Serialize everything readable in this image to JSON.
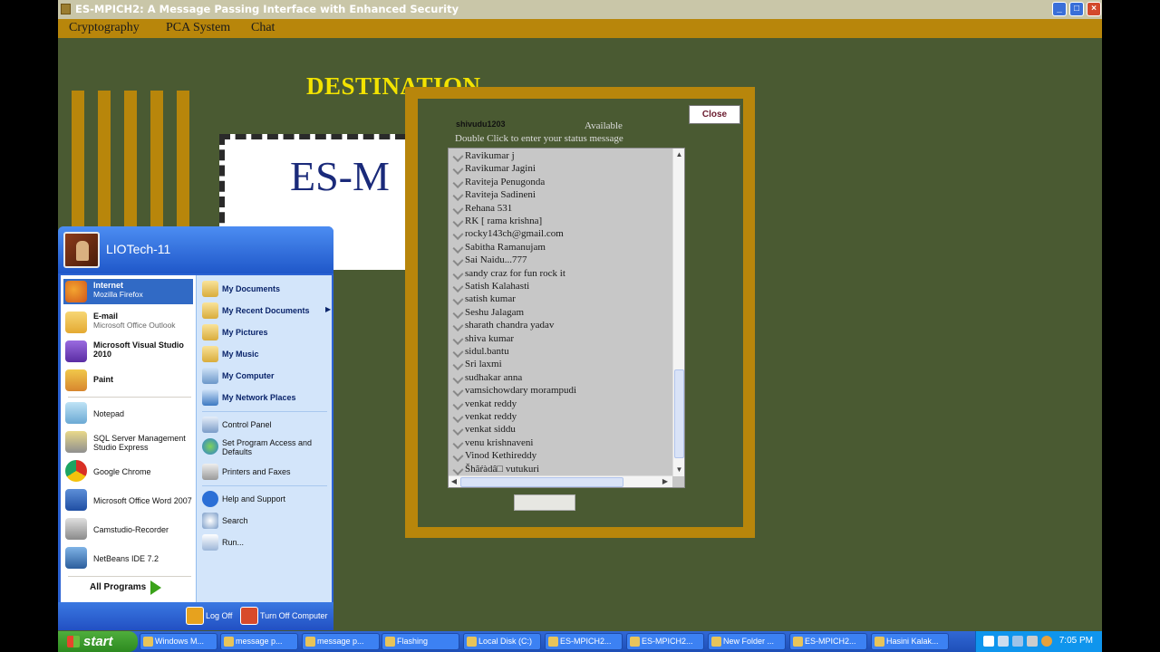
{
  "window": {
    "title": "ES-MPICH2: A Message Passing Interface with Enhanced Security",
    "min": "_",
    "max": "□",
    "close": "×"
  },
  "menu": [
    "Cryptography",
    "PCA System",
    "Chat"
  ],
  "destination": {
    "title": "DESTINATION",
    "logo_text": "ES-M"
  },
  "chat": {
    "username": "shivudu1203",
    "status": "Available",
    "hint": "Double Click to enter your status message",
    "close_label": "Close",
    "contacts": [
      "Ravikumar j",
      "Ravikumar Jagini",
      "Raviteja Penugonda",
      "Raviteja Sadineni",
      "Rehana 531",
      "RK [ rama krishna]",
      "rocky143ch@gmail.com",
      "Sabitha Ramanujam",
      "Sai Naidu...777",
      "sandy craz for fun rock it",
      "Satish Kalahasti",
      "satish kumar",
      "Seshu Jalagam",
      "sharath chandra yadav",
      "shiva kumar",
      "sidul.bantu",
      "Sri laxmi",
      "sudhakar anna",
      "vamsichowdary morampudi",
      "venkat reddy",
      "venkat reddy",
      "venkat siddu",
      "venu krishnaveni",
      "Vinod Kethireddy",
      "Šhãŕàdâ□ vutukuri"
    ]
  },
  "start_menu": {
    "user": "LIOTech-11",
    "pinned": [
      {
        "label": "Internet",
        "sub": "Mozilla Firefox"
      },
      {
        "label": "E-mail",
        "sub": "Microsoft Office Outlook"
      },
      {
        "label": "Microsoft Visual Studio 2010",
        "sub": ""
      },
      {
        "label": "Paint",
        "sub": ""
      }
    ],
    "recent": [
      "Notepad",
      "SQL Server Management Studio Express",
      "Google Chrome",
      "Microsoft Office Word 2007",
      "Camstudio-Recorder",
      "NetBeans IDE 7.2"
    ],
    "all_programs": "All Programs",
    "right": [
      "My Documents",
      "My Recent Documents",
      "My Pictures",
      "My Music",
      "My Computer",
      "My Network Places",
      "Control Panel",
      "Set Program Access and Defaults",
      "Printers and Faxes",
      "Help and Support",
      "Search",
      "Run..."
    ],
    "log_off": "Log Off",
    "turn_off": "Turn Off Computer"
  },
  "taskbar": {
    "start": "start",
    "tasks": [
      "Windows M...",
      "message p...",
      "message p...",
      "Flashing",
      "Local Disk (C:)",
      "ES-MPICH2...",
      "ES-MPICH2...",
      "New Folder ...",
      "ES-MPICH2...",
      "Hasini Kalak..."
    ],
    "clock": "7:05 PM"
  },
  "colors": {
    "accent": "#b8860b",
    "background": "#4a5a32",
    "title_yellow": "#f3e300"
  }
}
